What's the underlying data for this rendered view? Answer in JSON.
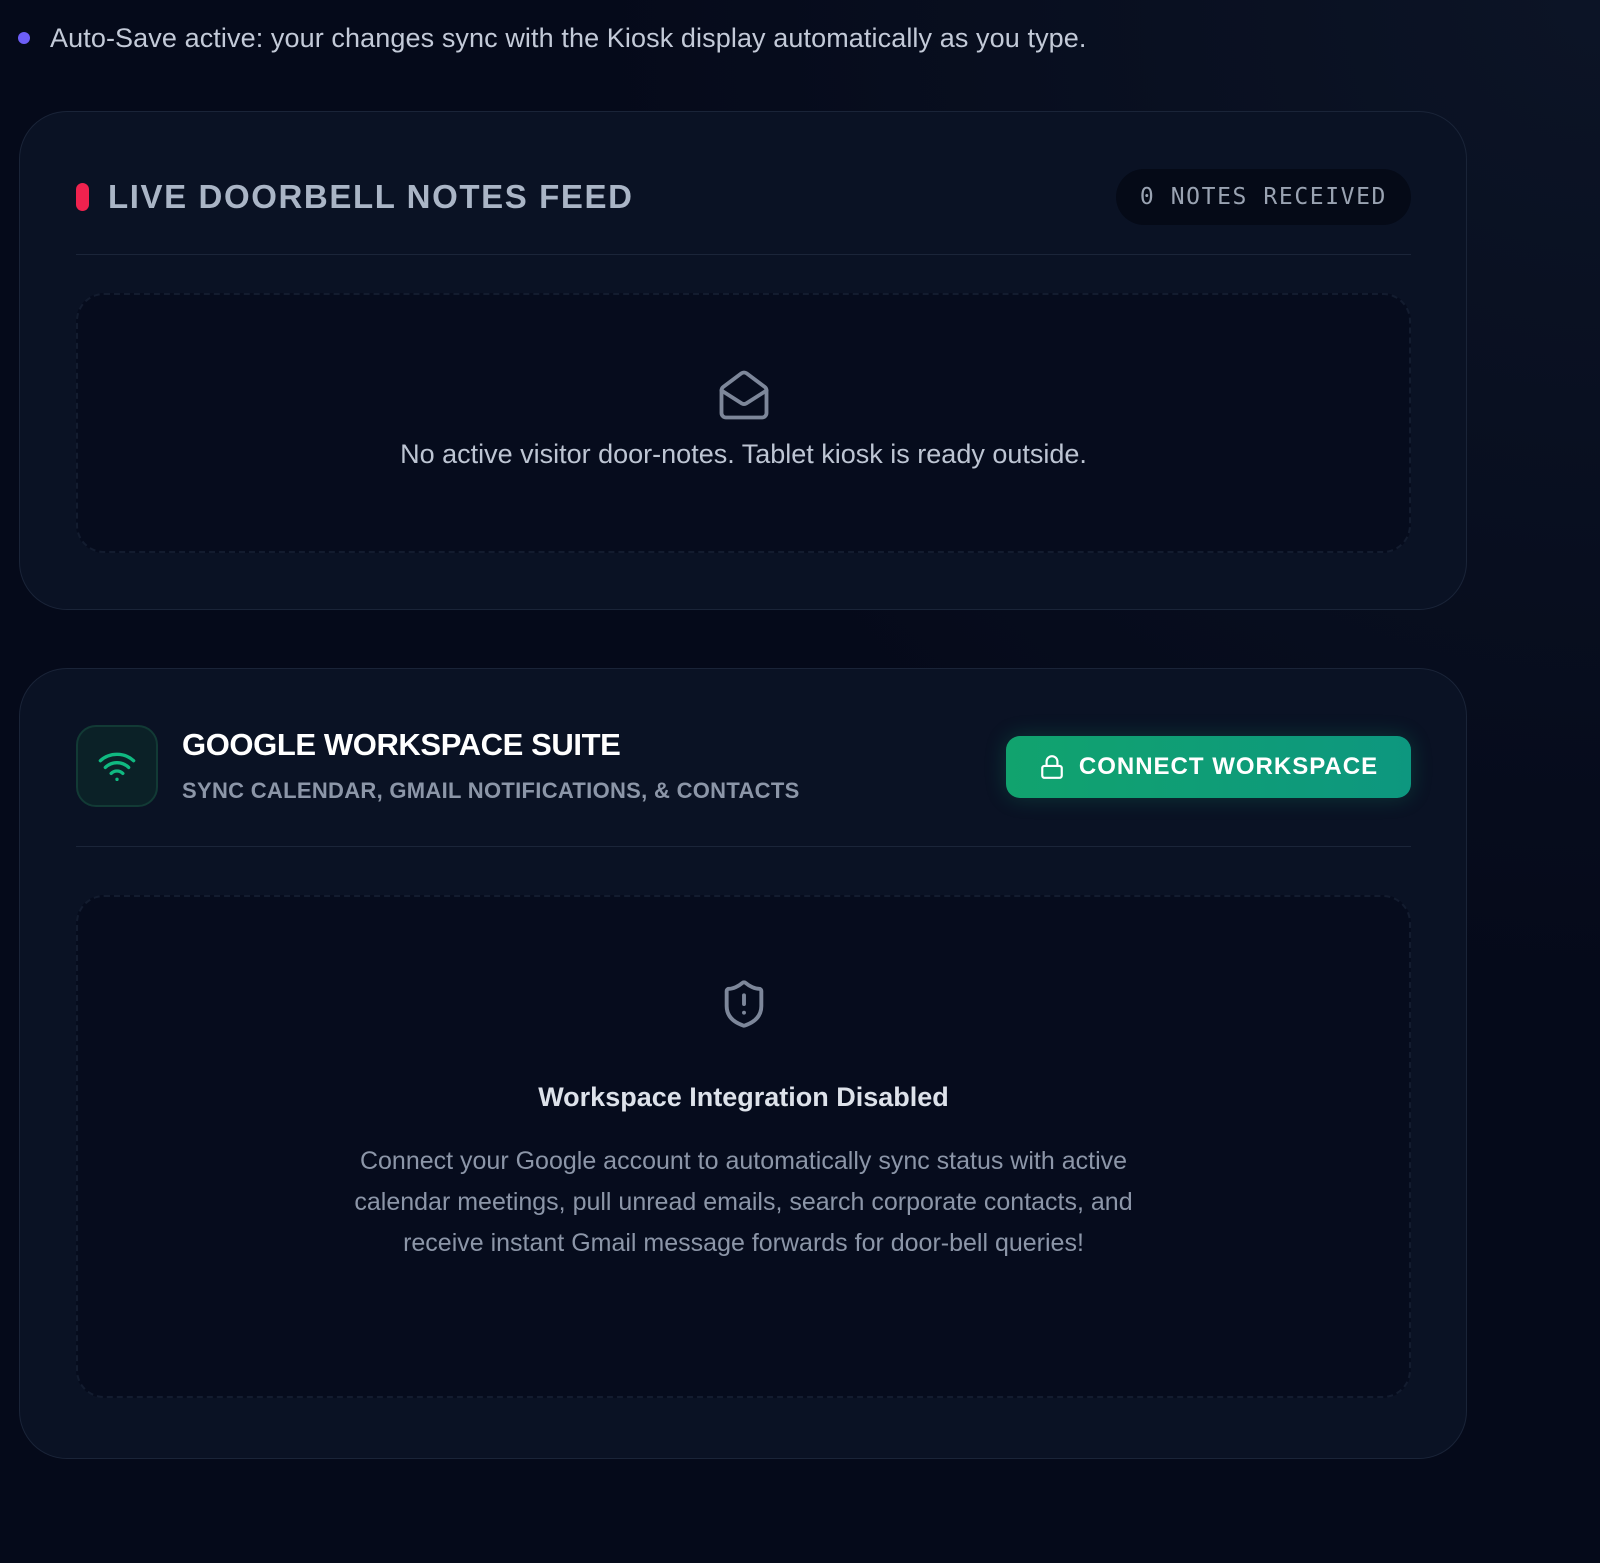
{
  "status": {
    "autosave_text": "Auto-Save active: your changes sync with the Kiosk display automatically as you type."
  },
  "feed": {
    "title": "LIVE DOORBELL NOTES FEED",
    "notes_count_label": "0 NOTES RECEIVED",
    "empty_message": "No active visitor door-notes. Tablet kiosk is ready outside.",
    "empty_icon": "mail-open-icon"
  },
  "workspace": {
    "logo_icon": "wifi-icon",
    "title": "GOOGLE WORKSPACE SUITE",
    "subtitle": "SYNC CALENDAR, GMAIL NOTIFICATIONS, & CONTACTS",
    "connect_button_label": "CONNECT WORKSPACE",
    "connect_button_icon": "lock-icon",
    "empty_icon": "shield-alert-icon",
    "empty_title": "Workspace Integration Disabled",
    "empty_description": "Connect your Google account to automatically sync status with active calendar meetings, pull unread emails, search corporate contacts, and receive instant Gmail message forwards for door-bell queries!"
  },
  "colors": {
    "background": "#050a1a",
    "panel": "#0a1224",
    "accent_purple": "#6d5ef6",
    "live_red": "#f0224e",
    "connect_green": "#10a37f"
  }
}
